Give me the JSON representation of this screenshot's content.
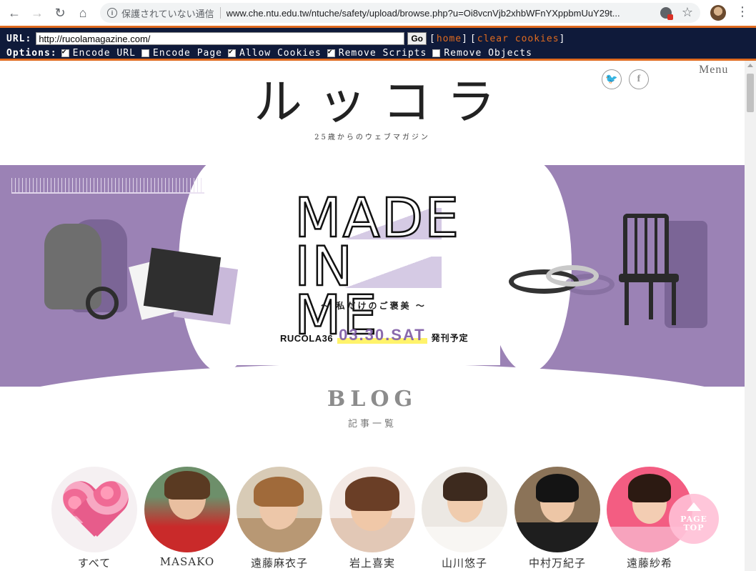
{
  "browser": {
    "insecure_label": "保護されていない通信",
    "url": "www.che.ntu.edu.tw/ntuche/safety/upload/browse.php?u=Oi8vcnVjb2xhbWFnYXppbmUuY29t..."
  },
  "proxy": {
    "url_label": "URL:",
    "url_value": "http://rucolamagazine.com/",
    "go_label": "Go",
    "home_label": "home",
    "clear_cookies_label": "clear cookies",
    "options_label": "Options:",
    "options": [
      {
        "label": "Encode URL",
        "checked": true
      },
      {
        "label": "Encode Page",
        "checked": false
      },
      {
        "label": "Allow Cookies",
        "checked": true
      },
      {
        "label": "Remove Scripts",
        "checked": true
      },
      {
        "label": "Remove Objects",
        "checked": false
      }
    ]
  },
  "site": {
    "logo": "ルッコラ",
    "tagline": "25歳からのウェブマガジン",
    "menu_label": "Menu",
    "social": [
      {
        "name": "twitter",
        "glyph": "🐦"
      },
      {
        "name": "facebook",
        "glyph": "f"
      }
    ]
  },
  "hero": {
    "title_line1": "MADE",
    "title_line2": "IN ME",
    "subtitle": "～ 私だけのご褒美 ～",
    "issue_name": "RUCOLA36",
    "issue_date": "03.30.SAT",
    "issue_note": "発刊予定"
  },
  "blog": {
    "title": "BLOG",
    "subtitle": "記事一覧",
    "writers": [
      {
        "name": "すべて"
      },
      {
        "name": "MASAKO"
      },
      {
        "name": "遠藤麻衣子"
      },
      {
        "name": "岩上喜実"
      },
      {
        "name": "山川悠子"
      },
      {
        "name": "中村万紀子"
      },
      {
        "name": "遠藤紗希"
      }
    ]
  },
  "page_top": {
    "line1": "PAGE",
    "line2": "TOP"
  },
  "colors": {
    "hero_purple": "#9b82b5",
    "accent_yellow": "#fff36b",
    "proxy_bg": "#0f1a3a",
    "proxy_accent": "#e06b1f"
  }
}
